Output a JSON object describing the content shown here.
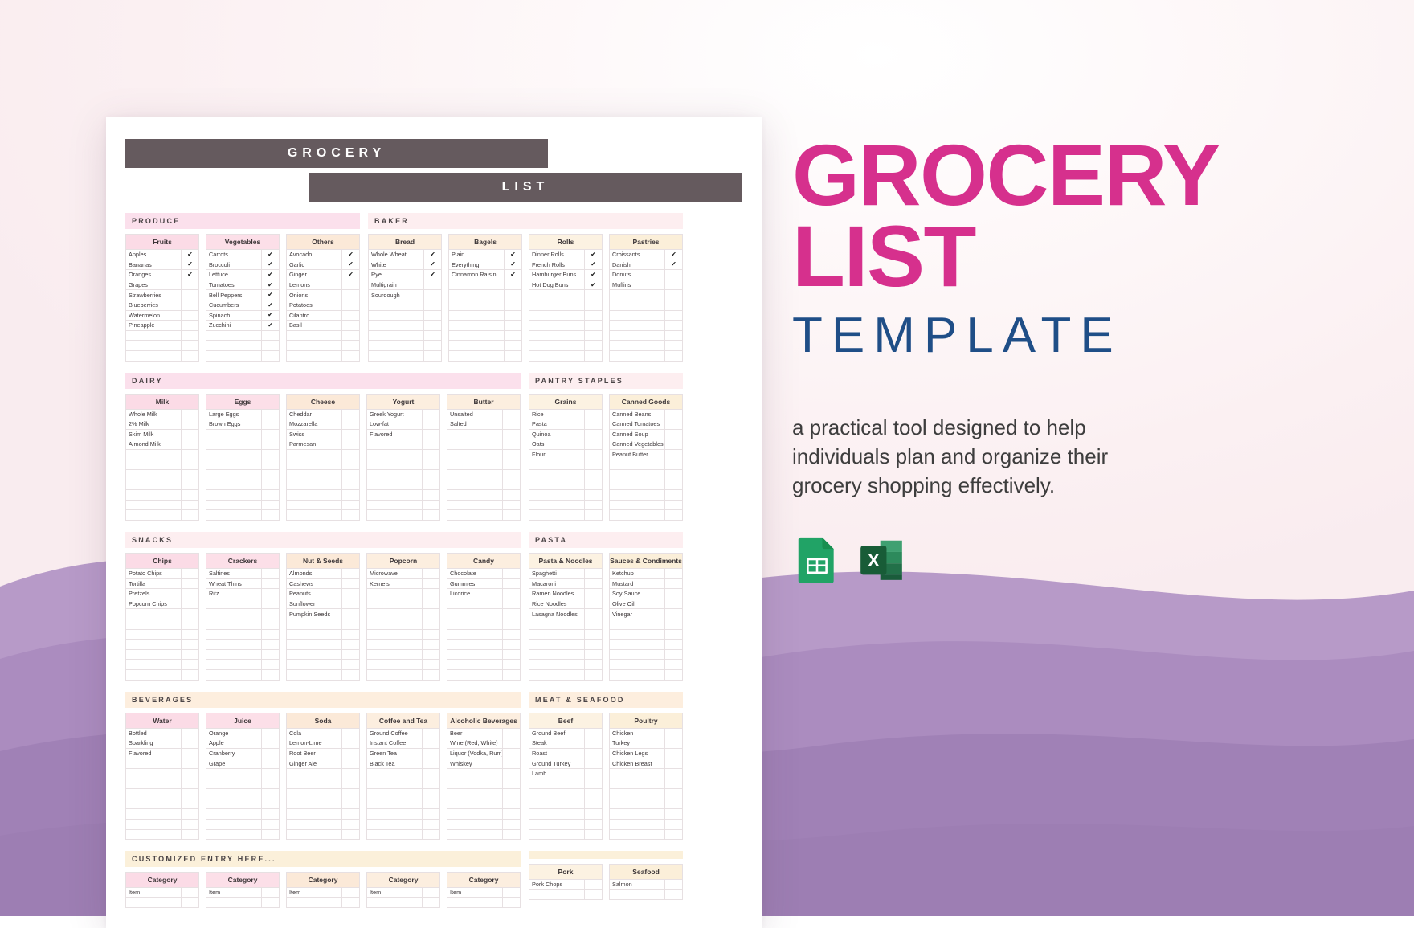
{
  "promo": {
    "title_line1": "GROCERY",
    "title_line2": "LIST",
    "subtitle": "TEMPLATE",
    "description": "a practical tool designed to help individuals plan and organize their grocery shopping effectively.",
    "brand_pink": "#d6308d",
    "brand_navy": "#1f4e87",
    "format_icons": [
      {
        "name": "google-sheets-icon",
        "label": "Google Sheets",
        "color": "#23a566"
      },
      {
        "name": "microsoft-excel-icon",
        "label": "Microsoft Excel",
        "color": "#1d6f42"
      }
    ]
  },
  "document": {
    "header": {
      "line1": "GROCERY",
      "line2": "LIST"
    },
    "checkmark": "✔",
    "rows_per_column": 11,
    "sections": [
      {
        "band": "PRODUCE",
        "band_style": "band-pink",
        "side": "left",
        "columns": [
          {
            "title": "Fruits",
            "head_style": "h-pink",
            "items": [
              {
                "name": "Apples",
                "checked": true
              },
              {
                "name": "Bananas",
                "checked": true
              },
              {
                "name": "Oranges",
                "checked": true
              },
              {
                "name": "Grapes",
                "checked": false
              },
              {
                "name": "Strawberries",
                "checked": false
              },
              {
                "name": "Blueberries",
                "checked": false
              },
              {
                "name": "Watermelon",
                "checked": false
              },
              {
                "name": "Pineapple",
                "checked": false
              }
            ]
          },
          {
            "title": "Vegetables",
            "head_style": "h-pink2",
            "items": [
              {
                "name": "Carrots",
                "checked": true
              },
              {
                "name": "Broccoli",
                "checked": true
              },
              {
                "name": "Lettuce",
                "checked": true
              },
              {
                "name": "Tomatoes",
                "checked": true
              },
              {
                "name": "Bell Peppers",
                "checked": true
              },
              {
                "name": "Cucumbers",
                "checked": true
              },
              {
                "name": "Spinach",
                "checked": true
              },
              {
                "name": "Zucchini",
                "checked": true
              }
            ]
          },
          {
            "title": "Others",
            "head_style": "h-peach",
            "items": [
              {
                "name": "Avocado",
                "checked": true
              },
              {
                "name": "Garlic",
                "checked": true
              },
              {
                "name": "Ginger",
                "checked": true
              },
              {
                "name": "Lemons",
                "checked": false
              },
              {
                "name": "Onions",
                "checked": false
              },
              {
                "name": "Potatoes",
                "checked": false
              },
              {
                "name": "Cilantro",
                "checked": false
              },
              {
                "name": "Basil",
                "checked": false
              }
            ]
          }
        ]
      },
      {
        "band": "BAKER",
        "band_style": "band-pinklight",
        "side": "right",
        "columns": [
          {
            "title": "Bread",
            "head_style": "h-peach2",
            "items": [
              {
                "name": "Whole Wheat",
                "checked": true
              },
              {
                "name": "White",
                "checked": true
              },
              {
                "name": "Rye",
                "checked": true
              },
              {
                "name": "Multigrain",
                "checked": false
              },
              {
                "name": "Sourdough",
                "checked": false
              }
            ]
          },
          {
            "title": "Bagels",
            "head_style": "h-peach2",
            "items": [
              {
                "name": "Plain",
                "checked": true
              },
              {
                "name": "Everything",
                "checked": true
              },
              {
                "name": "Cinnamon Raisin",
                "checked": true
              }
            ]
          },
          {
            "title": "Rolls",
            "head_style": "h-cream2",
            "items": [
              {
                "name": "Dinner Rolls",
                "checked": true
              },
              {
                "name": "French Rolls",
                "checked": true
              },
              {
                "name": "Hamburger Buns",
                "checked": true
              },
              {
                "name": "Hot Dog Buns",
                "checked": true
              }
            ]
          },
          {
            "title": "Pastries",
            "head_style": "h-cream",
            "items": [
              {
                "name": "Croissants",
                "checked": true
              },
              {
                "name": "Danish",
                "checked": true
              },
              {
                "name": "Donuts",
                "checked": false
              },
              {
                "name": "Muffins",
                "checked": false
              }
            ]
          }
        ]
      },
      {
        "band": "DAIRY",
        "band_style": "band-pink",
        "side": "left",
        "columns": [
          {
            "title": "Milk",
            "head_style": "h-pink",
            "items": [
              {
                "name": "Whole Milk",
                "checked": false
              },
              {
                "name": "2% Milk",
                "checked": false
              },
              {
                "name": "Skim Milk",
                "checked": false
              },
              {
                "name": "Almond Milk",
                "checked": false
              }
            ]
          },
          {
            "title": "Eggs",
            "head_style": "h-pink2",
            "items": [
              {
                "name": "Large Eggs",
                "checked": false
              },
              {
                "name": "Brown Eggs",
                "checked": false
              }
            ]
          },
          {
            "title": "Cheese",
            "head_style": "h-peach",
            "items": [
              {
                "name": "Cheddar",
                "checked": false
              },
              {
                "name": "Mozzarella",
                "checked": false
              },
              {
                "name": "Swiss",
                "checked": false
              },
              {
                "name": "Parmesan",
                "checked": false
              }
            ]
          },
          {
            "title": "Yogurt",
            "head_style": "h-peach2",
            "items": [
              {
                "name": "Greek Yogurt",
                "checked": false
              },
              {
                "name": "Low-fat",
                "checked": false
              },
              {
                "name": "Flavored",
                "checked": false
              }
            ]
          },
          {
            "title": "Butter",
            "head_style": "h-peach2",
            "items": [
              {
                "name": "Unsalted",
                "checked": false
              },
              {
                "name": "Salted",
                "checked": false
              }
            ]
          }
        ]
      },
      {
        "band": "PANTRY STAPLES",
        "band_style": "band-pinklight",
        "side": "right",
        "columns": [
          {
            "title": "Grains",
            "head_style": "h-cream2",
            "items": [
              {
                "name": "Rice",
                "checked": false
              },
              {
                "name": "Pasta",
                "checked": false
              },
              {
                "name": "Quinoa",
                "checked": false
              },
              {
                "name": "Oats",
                "checked": false
              },
              {
                "name": "Flour",
                "checked": false
              }
            ]
          },
          {
            "title": "Canned Goods",
            "head_style": "h-cream",
            "items": [
              {
                "name": "Canned Beans",
                "checked": false
              },
              {
                "name": "Canned Tomatoes",
                "checked": false
              },
              {
                "name": "Canned Soup",
                "checked": false
              },
              {
                "name": "Canned Vegetables",
                "checked": false
              },
              {
                "name": "Peanut Butter",
                "checked": false
              }
            ]
          }
        ]
      },
      {
        "band": "SNACKS",
        "band_style": "band-pinklight",
        "side": "left",
        "columns": [
          {
            "title": "Chips",
            "head_style": "h-pink",
            "items": [
              {
                "name": "Potato Chips",
                "checked": false
              },
              {
                "name": "Tortilla",
                "checked": false
              },
              {
                "name": "Pretzels",
                "checked": false
              },
              {
                "name": "Popcorn Chips",
                "checked": false
              }
            ]
          },
          {
            "title": "Crackers",
            "head_style": "h-pink2",
            "items": [
              {
                "name": "Saltines",
                "checked": false
              },
              {
                "name": "Wheat Thins",
                "checked": false
              },
              {
                "name": "Ritz",
                "checked": false
              }
            ]
          },
          {
            "title": "Nut & Seeds",
            "head_style": "h-peach",
            "items": [
              {
                "name": "Almonds",
                "checked": false
              },
              {
                "name": "Cashews",
                "checked": false
              },
              {
                "name": "Peanuts",
                "checked": false
              },
              {
                "name": "Sunflower",
                "checked": false
              },
              {
                "name": "Pumpkin Seeds",
                "checked": false
              }
            ]
          },
          {
            "title": "Popcorn",
            "head_style": "h-peach2",
            "items": [
              {
                "name": "Microwave",
                "checked": false
              },
              {
                "name": "Kernels",
                "checked": false
              }
            ]
          },
          {
            "title": "Candy",
            "head_style": "h-peach2",
            "items": [
              {
                "name": "Chocolate",
                "checked": false
              },
              {
                "name": "Gummies",
                "checked": false
              },
              {
                "name": "Licorice",
                "checked": false
              }
            ]
          }
        ]
      },
      {
        "band": "PASTA",
        "band_style": "band-pinklight",
        "side": "right",
        "columns": [
          {
            "title": "Pasta & Noodles",
            "head_style": "h-cream2",
            "items": [
              {
                "name": "Spaghetti",
                "checked": false
              },
              {
                "name": "Macaroni",
                "checked": false
              },
              {
                "name": "Ramen Noodles",
                "checked": false
              },
              {
                "name": "Rice Noodles",
                "checked": false
              },
              {
                "name": "Lasagna Noodles",
                "checked": false
              }
            ]
          },
          {
            "title": "Sauces & Condiments",
            "head_style": "h-cream",
            "items": [
              {
                "name": "Ketchup",
                "checked": false
              },
              {
                "name": "Mustard",
                "checked": false
              },
              {
                "name": "Soy Sauce",
                "checked": false
              },
              {
                "name": "Olive Oil",
                "checked": false
              },
              {
                "name": "Vinegar",
                "checked": false
              }
            ]
          }
        ]
      },
      {
        "band": "BEVERAGES",
        "band_style": "band-peach",
        "side": "left",
        "columns": [
          {
            "title": "Water",
            "head_style": "h-pink",
            "items": [
              {
                "name": "Bottled",
                "checked": false
              },
              {
                "name": "Sparkling",
                "checked": false
              },
              {
                "name": "Flavored",
                "checked": false
              }
            ]
          },
          {
            "title": "Juice",
            "head_style": "h-pink2",
            "items": [
              {
                "name": "Orange",
                "checked": false
              },
              {
                "name": "Apple",
                "checked": false
              },
              {
                "name": "Cranberry",
                "checked": false
              },
              {
                "name": "Grape",
                "checked": false
              }
            ]
          },
          {
            "title": "Soda",
            "head_style": "h-peach",
            "items": [
              {
                "name": "Cola",
                "checked": false
              },
              {
                "name": "Lemon-Lime",
                "checked": false
              },
              {
                "name": "Root Beer",
                "checked": false
              },
              {
                "name": "Ginger Ale",
                "checked": false
              }
            ]
          },
          {
            "title": "Coffee and Tea",
            "head_style": "h-peach2",
            "items": [
              {
                "name": "Ground Coffee",
                "checked": false
              },
              {
                "name": "Instant Coffee",
                "checked": false
              },
              {
                "name": "Green Tea",
                "checked": false
              },
              {
                "name": "Black Tea",
                "checked": false
              }
            ]
          },
          {
            "title": "Alcoholic Beverages",
            "head_style": "h-peach2",
            "items": [
              {
                "name": "Beer",
                "checked": false
              },
              {
                "name": "Wine (Red, White)",
                "checked": false
              },
              {
                "name": "Liquor (Vodka, Rum)",
                "checked": false
              },
              {
                "name": "Whiskey",
                "checked": false
              }
            ]
          }
        ]
      },
      {
        "band": "MEAT & SEAFOOD",
        "band_style": "band-peach",
        "side": "right",
        "columns": [
          {
            "title": "Beef",
            "head_style": "h-cream2",
            "items": [
              {
                "name": "Ground Beef",
                "checked": false
              },
              {
                "name": "Steak",
                "checked": false
              },
              {
                "name": "Roast",
                "checked": false
              },
              {
                "name": "Ground Turkey",
                "checked": false
              },
              {
                "name": "Lamb",
                "checked": false
              }
            ]
          },
          {
            "title": "Poultry",
            "head_style": "h-cream",
            "items": [
              {
                "name": "Chicken",
                "checked": false
              },
              {
                "name": "Turkey",
                "checked": false
              },
              {
                "name": "Chicken Legs",
                "checked": false
              },
              {
                "name": "Chicken Breast",
                "checked": false
              }
            ]
          }
        ]
      },
      {
        "band": "CUSTOMIZED ENTRY HERE...",
        "band_style": "band-cream",
        "side": "left",
        "rows": 2,
        "columns": [
          {
            "title": "Category",
            "head_style": "h-pink",
            "items": [
              {
                "name": "Item",
                "checked": false
              }
            ]
          },
          {
            "title": "Category",
            "head_style": "h-pink2",
            "items": [
              {
                "name": "Item",
                "checked": false
              }
            ]
          },
          {
            "title": "Category",
            "head_style": "h-peach",
            "items": [
              {
                "name": "Item",
                "checked": false
              }
            ]
          },
          {
            "title": "Category",
            "head_style": "h-peach2",
            "items": [
              {
                "name": "Item",
                "checked": false
              }
            ]
          },
          {
            "title": "Category",
            "head_style": "h-peach2",
            "items": [
              {
                "name": "Item",
                "checked": false
              }
            ]
          }
        ]
      },
      {
        "band": "",
        "band_style": "band-cream",
        "side": "right",
        "rows": 2,
        "columns": [
          {
            "title": "Pork",
            "head_style": "h-cream2",
            "items": [
              {
                "name": "Pork Chops",
                "checked": false
              }
            ]
          },
          {
            "title": "Seafood",
            "head_style": "h-cream",
            "items": [
              {
                "name": "Salmon",
                "checked": false
              }
            ]
          }
        ]
      }
    ]
  }
}
